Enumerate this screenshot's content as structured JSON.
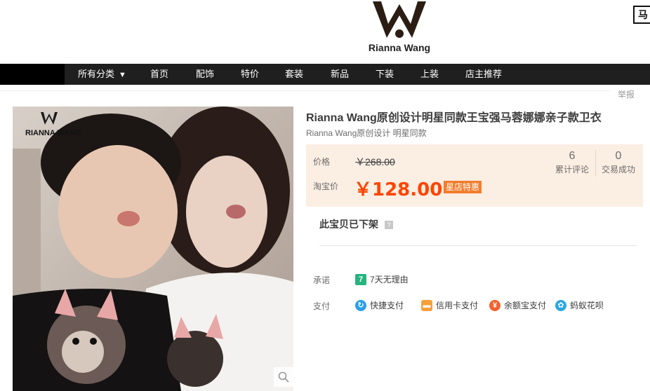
{
  "brand": {
    "logo_text": "Rianna Wang",
    "corner_char": "马"
  },
  "nav": {
    "items": [
      "所有分类",
      "首页",
      "配饰",
      "特价",
      "套装",
      "新品",
      "下装",
      "上装",
      "店主推荐"
    ],
    "category_arrow": "▼"
  },
  "report": {
    "label": "举报"
  },
  "product": {
    "image_watermark": "RIANNA WANG",
    "title": "Rianna Wang原创设计明星同款王宝强马蓉娜娜亲子款卫衣",
    "subtitle": "Rianna Wang原创设计 明星同款",
    "price_label": "价格",
    "original_price": "￥268.00",
    "promo_label": "淘宝价",
    "promo_price": "￥128.00",
    "promo_badge": "星店特惠",
    "stats": [
      {
        "value": "6",
        "label": "累计评论"
      },
      {
        "value": "0",
        "label": "交易成功"
      }
    ],
    "status": "此宝贝已下架",
    "help": "?"
  },
  "promise": {
    "label": "承诺",
    "item": "7天无理由",
    "item_icon": "7"
  },
  "payment": {
    "label": "支付",
    "methods": [
      {
        "label": "快捷支付",
        "icon": "quick-pay-icon",
        "color": "#2b9ee8"
      },
      {
        "label": "信用卡支付",
        "icon": "credit-card-icon",
        "color": "#f5a03c"
      },
      {
        "label": "余额宝支付",
        "icon": "yuebao-icon",
        "color": "#f2622e"
      },
      {
        "label": "蚂蚁花呗",
        "icon": "huabei-icon",
        "color": "#2aa7e4"
      }
    ]
  },
  "colors": {
    "accent": "#ff4400",
    "price_bg": "#fbeee2",
    "nav_bg": "#1f1f1f",
    "badge": "#f37d2b",
    "promise_green": "#27b47f"
  }
}
